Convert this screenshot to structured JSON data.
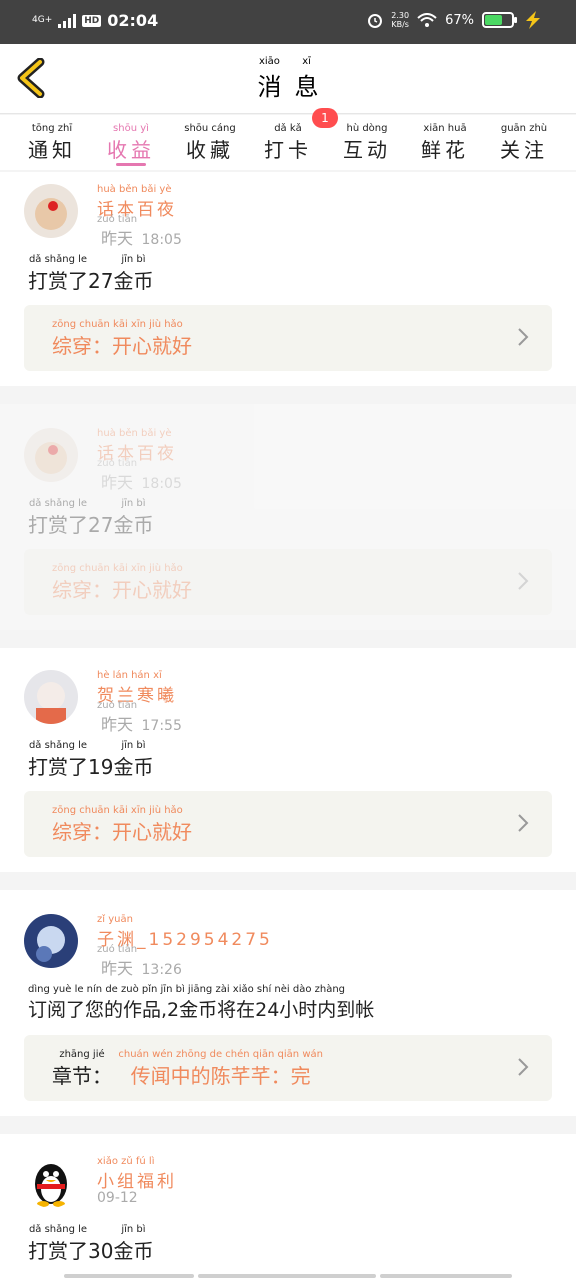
{
  "status_bar": {
    "network": "4G+",
    "hd": "HD",
    "time": "02:04",
    "speed_value": "2.30",
    "speed_unit": "KB/s",
    "battery": "67%",
    "battery_level": 0.67
  },
  "header": {
    "title": [
      {
        "hz": "消",
        "py": "xiāo"
      },
      {
        "hz": "息",
        "py": "xī"
      }
    ]
  },
  "tabs": [
    {
      "hz": "通知",
      "py": "tōng  zhī"
    },
    {
      "hz": "收益",
      "py": "shōu  yì"
    },
    {
      "hz": "收藏",
      "py": "shōu cáng"
    },
    {
      "hz": "打卡",
      "py": "dǎ  kǎ"
    },
    {
      "hz": "互动",
      "py": "hù  dòng"
    },
    {
      "hz": "鲜花",
      "py": "xiān huā"
    },
    {
      "hz": "关注",
      "py": "guān zhù"
    }
  ],
  "tab_badge": "1",
  "messages": [
    {
      "user": "话本百夜",
      "user_py": "huà běn bǎi yè",
      "day": "昨天",
      "day_py": "zuó tiān",
      "time": "18:05",
      "text_a": "打赏了",
      "text_a_py": "dǎ shǎng le",
      "amount": "27",
      "text_b": "金币",
      "text_b_py": "jīn bì",
      "link": "综穿：开心就好",
      "link_py": "zōng chuān   kāi xīn jiù hǎo"
    },
    {
      "user": "话本百夜",
      "user_py": "huà běn bǎi yè",
      "day": "昨天",
      "day_py": "zuó tiān",
      "time": "18:05",
      "text_a": "打赏了",
      "text_a_py": "dǎ shǎng le",
      "amount": "27",
      "text_b": "金币",
      "text_b_py": "jīn bì",
      "link": "综穿：开心就好",
      "link_py": "zōng chuān   kāi xīn jiù hǎo"
    },
    {
      "user": "贺兰寒曦",
      "user_py": "hè lán hán xī",
      "day": "昨天",
      "day_py": "zuó tiān",
      "time": "17:55",
      "text_a": "打赏了",
      "text_a_py": "dǎ shǎng le",
      "amount": "19",
      "text_b": "金币",
      "text_b_py": "jīn bì",
      "link": "综穿：开心就好",
      "link_py": "zōng chuān   kāi xīn jiù hǎo"
    },
    {
      "user": "子渊_152954275",
      "user_py": "zǐ yuān",
      "day": "昨天",
      "day_py": "zuó tiān",
      "time": "13:26",
      "text_full": "订阅了您的作品,2金币将在24小时内到帐",
      "text_full_py": "dìng yuè le nín de zuò pǐn  jīn bì jiāng zài  xiǎo shí nèi dào zhàng",
      "link_prefix": "章节：",
      "link_prefix_py": "zhāng jié",
      "link": "传闻中的陈芊芊：完",
      "link_py": "chuán wén zhōng de chén qiān qiān   wán"
    },
    {
      "user": "小组福利",
      "user_py": "xiǎo zǔ fú lì",
      "day": "09-12",
      "text_a": "打赏了",
      "text_a_py": "dǎ shǎng le",
      "amount": "30",
      "text_b": "金币",
      "text_b_py": "jīn bì"
    }
  ],
  "icons": {
    "back": "back-arrow-icon",
    "chevron": "chevron-right-icon",
    "alarm": "alarm-icon",
    "wifi": "wifi-icon",
    "charging": "charging-bolt-icon"
  },
  "colors": {
    "accent": "#e577b0",
    "username": "#f08a5d",
    "badge": "#ff4d4f",
    "statusbar": "#424242"
  }
}
